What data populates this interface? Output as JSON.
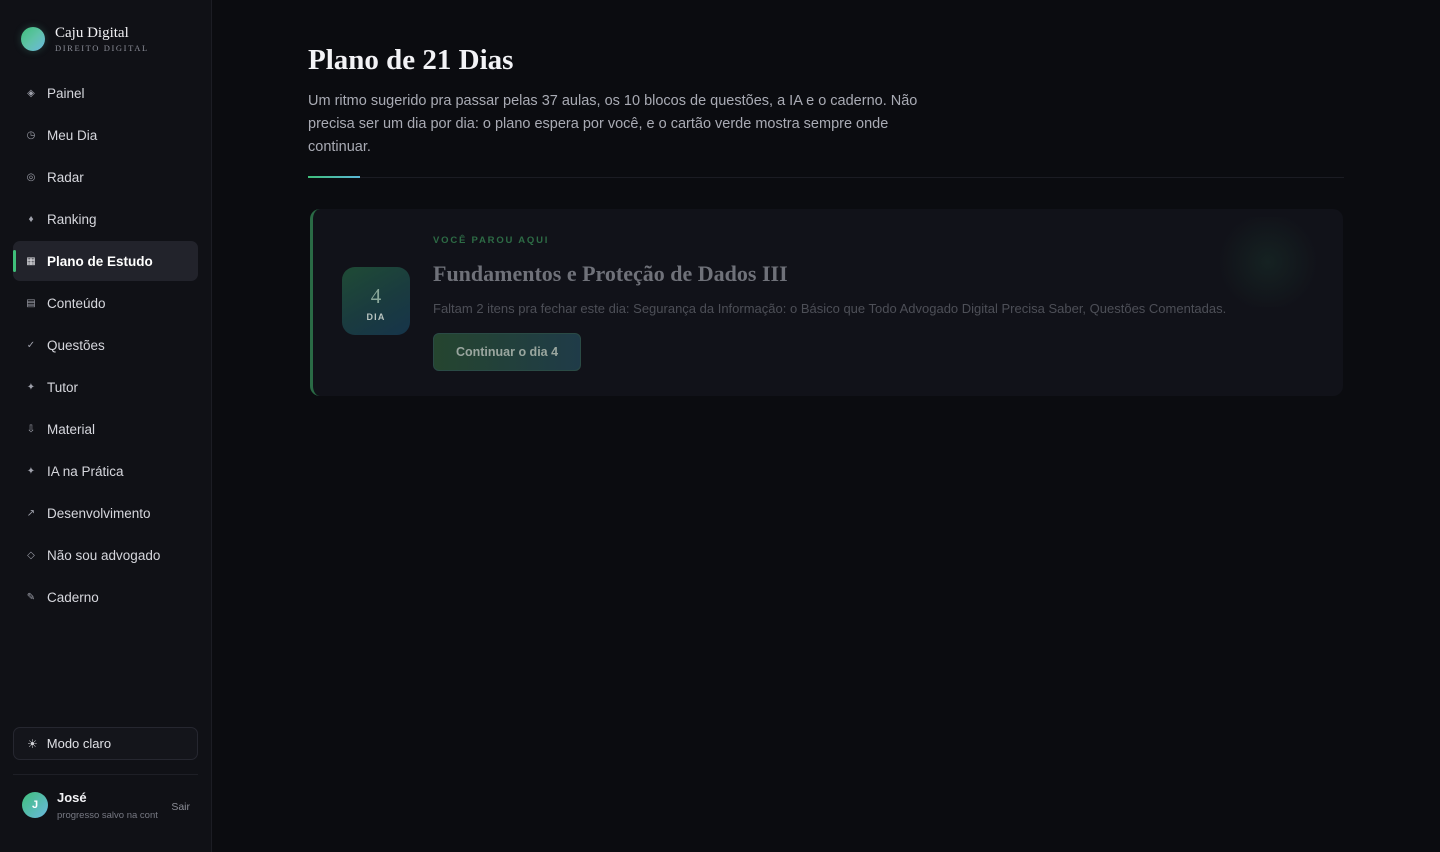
{
  "brand": {
    "name": "Caju Digital",
    "subtitle": "DIREITO DIGITAL",
    "accent_color": "#3fbf7a"
  },
  "sidebar": {
    "items": [
      {
        "label": "Painel",
        "icon": "diamond-dot-icon",
        "glyph": "◈",
        "active": false
      },
      {
        "label": "Meu Dia",
        "icon": "clock-icon",
        "glyph": "◷",
        "active": false
      },
      {
        "label": "Radar",
        "icon": "radar-icon",
        "glyph": "◎",
        "active": false
      },
      {
        "label": "Ranking",
        "icon": "diamond-icon",
        "glyph": "♦",
        "active": false
      },
      {
        "label": "Plano de Estudo",
        "icon": "grid-icon",
        "glyph": "▦",
        "active": true
      },
      {
        "label": "Conteúdo",
        "icon": "list-icon",
        "glyph": "▤",
        "active": false
      },
      {
        "label": "Questões",
        "icon": "check-icon",
        "glyph": "✓",
        "active": false
      },
      {
        "label": "Tutor",
        "icon": "sparkle-icon",
        "glyph": "✦",
        "active": false
      },
      {
        "label": "Material",
        "icon": "download-icon",
        "glyph": "⇩",
        "active": false
      },
      {
        "label": "IA na Prática",
        "icon": "sparkle-icon",
        "glyph": "✦",
        "active": false
      },
      {
        "label": "Desenvolvimento",
        "icon": "arrow-up-right-icon",
        "glyph": "↗",
        "active": false
      },
      {
        "label": "Não sou advogado",
        "icon": "diamond-outline-icon",
        "glyph": "◇",
        "active": false
      },
      {
        "label": "Caderno",
        "icon": "pencil-icon",
        "glyph": "✎",
        "active": false
      }
    ],
    "theme_toggle": {
      "label": "Modo claro",
      "icon": "sun-icon",
      "glyph": "☀"
    },
    "user": {
      "initial": "J",
      "name": "José",
      "status": "progresso salvo na cont",
      "logout_label": "Sair"
    }
  },
  "main": {
    "title": "Plano de 21 Dias",
    "description": "Um ritmo sugerido pra passar pelas 37 aulas, os 10 blocos de questões, a IA e o caderno. Não precisa ser um dia por dia: o plano espera por você, e o cartão verde mostra sempre onde continuar.",
    "resume_card": {
      "kicker": "VOCÊ PAROU AQUI",
      "day_number": "4",
      "day_label": "DIA",
      "title": "Fundamentos e Proteção de Dados III",
      "description": "Faltam 2 itens pra fechar este dia: Segurança da Informação: o Básico que Todo Advogado Digital Precisa Saber, Questões Comentadas.",
      "button_label": "Continuar o dia 4"
    }
  }
}
